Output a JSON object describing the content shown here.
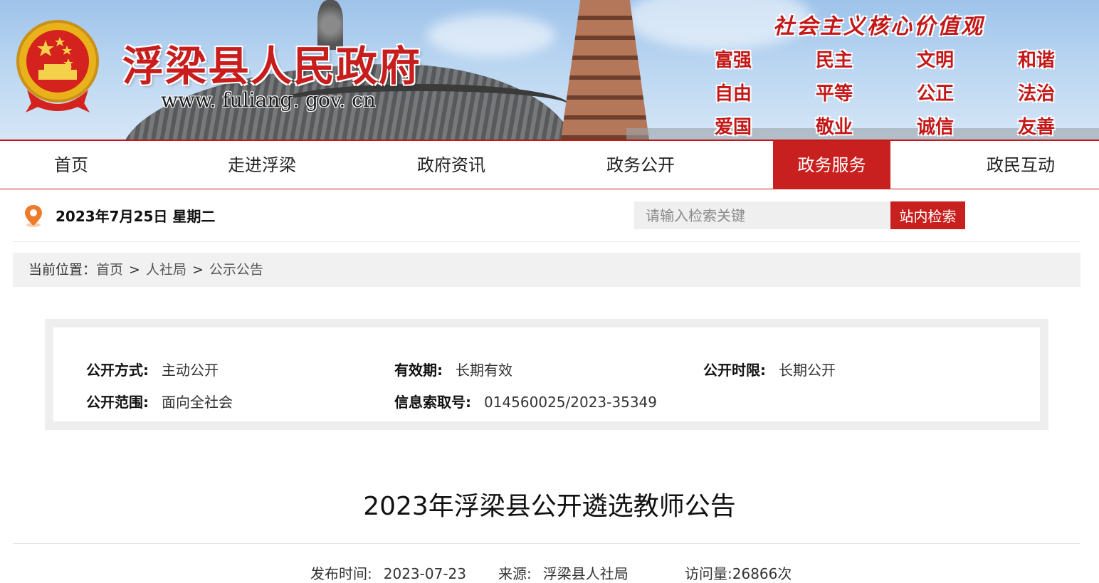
{
  "header": {
    "site_title": "浮梁县人民政府",
    "site_url": "www. fuliang. gov. cn",
    "values_title": "社会主义核心价值观",
    "values": [
      "富强",
      "民主",
      "文明",
      "和谐",
      "自由",
      "平等",
      "公正",
      "法治",
      "爱国",
      "敬业",
      "诚信",
      "友善"
    ],
    "emblem_icon": "national-emblem-icon"
  },
  "nav": {
    "items": [
      "首页",
      "走进浮梁",
      "政府资讯",
      "政务公开",
      "政务服务",
      "政民互动"
    ],
    "active": "政务服务",
    "accent_color": "#c8201e"
  },
  "infobar": {
    "date": "2023年7月25日 星期二",
    "location_icon": "location-pin-icon",
    "search_placeholder": "请输入检索关键",
    "search_button": "站内检索"
  },
  "breadcrumb": {
    "label": "当前位置：",
    "items": [
      "首页",
      "人社局",
      "公示公告"
    ],
    "separator": ">"
  },
  "disclosure": {
    "mode_label": "公开方式:",
    "mode_value": "主动公开",
    "validity_label": "有效期:",
    "validity_value": "长期有效",
    "term_label": "公开时限:",
    "term_value": "长期公开",
    "scope_label": "公开范围:",
    "scope_value": "面向全社会",
    "index_label": "信息索取号:",
    "index_value": "014560025/2023-35349"
  },
  "article": {
    "title": "2023年浮梁县公开遴选教师公告",
    "publish_label": "发布时间:",
    "publish_value": "2023-07-23",
    "source_label": "来源:",
    "source_value": "浮梁县人社局",
    "views_label": "访问量:",
    "views_value": "26866次"
  }
}
